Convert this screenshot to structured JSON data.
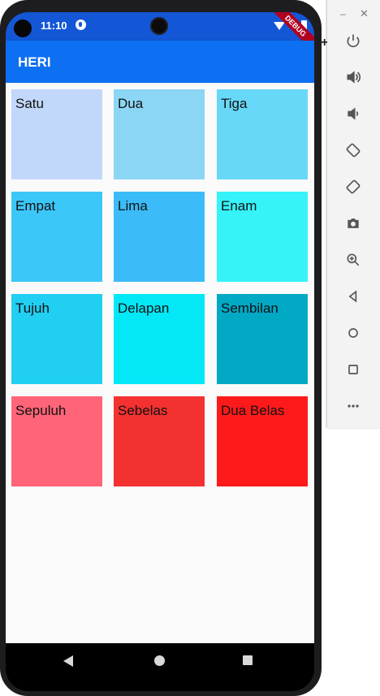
{
  "status_bar": {
    "time": "11:10"
  },
  "debug_banner": "DEBUG",
  "app_bar": {
    "title": "HERI"
  },
  "tiles": [
    {
      "label": "Satu",
      "color": "#c2d8fa"
    },
    {
      "label": "Dua",
      "color": "#8bd6f5"
    },
    {
      "label": "Tiga",
      "color": "#67d8f7"
    },
    {
      "label": "Empat",
      "color": "#3cc7f9"
    },
    {
      "label": "Lima",
      "color": "#3bbcf8"
    },
    {
      "label": "Enam",
      "color": "#35f3f8"
    },
    {
      "label": "Tujuh",
      "color": "#21cff3"
    },
    {
      "label": "Delapan",
      "color": "#03e8f7"
    },
    {
      "label": "Sembilan",
      "color": "#02a9c5"
    },
    {
      "label": "Sepuluh",
      "color": "#ff6478"
    },
    {
      "label": "Sebelas",
      "color": "#f33131"
    },
    {
      "label": "Dua Belas",
      "color": "#fe1a1a"
    }
  ],
  "emulator_toolbar": {
    "items": [
      "power-icon",
      "volume-up-icon",
      "volume-down-icon",
      "rotate-left-icon",
      "rotate-right-icon",
      "camera-icon",
      "zoom-icon",
      "back-icon",
      "home-icon",
      "overview-icon",
      "more-icon"
    ]
  }
}
